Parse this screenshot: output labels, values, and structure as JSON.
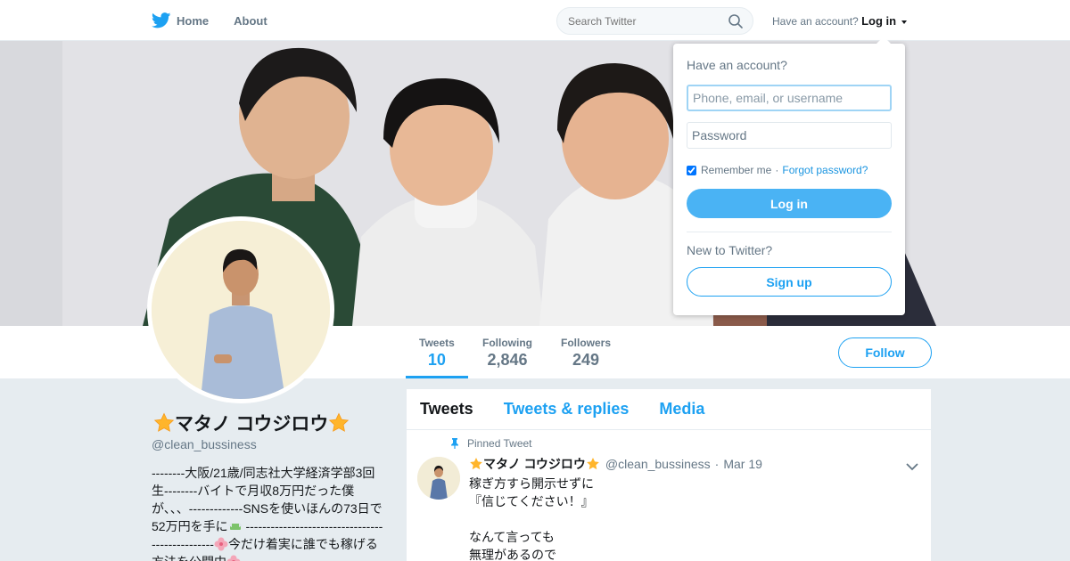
{
  "nav": {
    "home_label": "Home",
    "about_label": "About",
    "search_placeholder": "Search Twitter",
    "have_account": "Have an account?",
    "login_label": "Log in",
    "brand_color": "#1da1f2"
  },
  "profile": {
    "name": "マタノ コウジロウ",
    "handle": "@clean_bussiness",
    "bio_1": "--------大阪/21歳/同志社大学経済学部3回生--------バイトで月収8万円だった僕が、、、-------------SNSを使いほんの73日で52万円を手に",
    "bio_2": " ------------------------------------------------",
    "bio_3": "今だけ着実に誰でも稼げる方法を公開中",
    "stats": [
      {
        "label": "Tweets",
        "value": "10"
      },
      {
        "label": "Following",
        "value": "2,846"
      },
      {
        "label": "Followers",
        "value": "249"
      }
    ],
    "follow_label": "Follow"
  },
  "timeline": {
    "tabs": [
      "Tweets",
      "Tweets & replies",
      "Media"
    ],
    "pinned_label": "Pinned Tweet",
    "tweet": {
      "name": "マタノ コウジロウ",
      "handle": "@clean_bussiness",
      "date": "Mar 19",
      "text": "稼ぎ方すら開示せずに\n『信じてください！』\n\nなんて言っても\n無理があるので"
    }
  },
  "login_dropdown": {
    "title": "Have an account?",
    "username_placeholder": "Phone, email, or username",
    "password_placeholder": "Password",
    "remember_label": "Remember me",
    "separator": "·",
    "forgot_label": "Forgot password?",
    "login_button": "Log in",
    "new_label": "New to Twitter?",
    "signup_button": "Sign up",
    "remember_checked": true
  }
}
